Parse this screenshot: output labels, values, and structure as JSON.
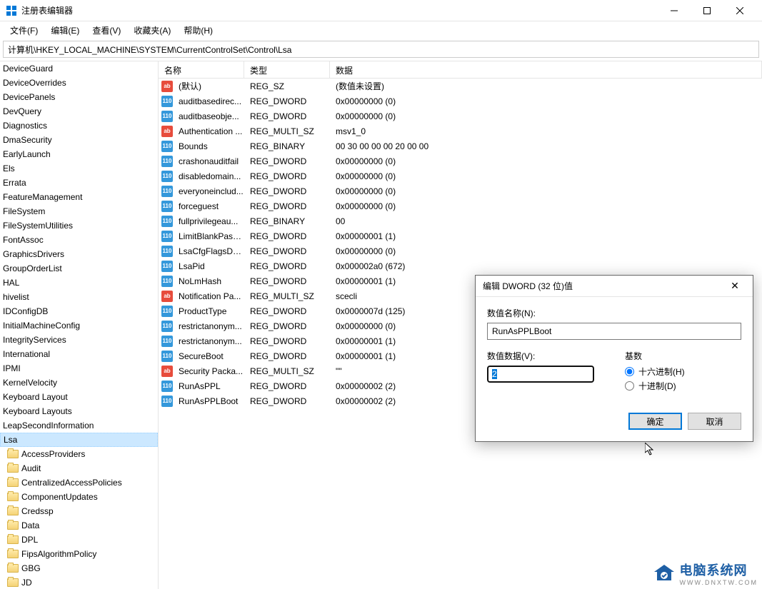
{
  "window": {
    "title": "注册表编辑器",
    "address": "计算机\\HKEY_LOCAL_MACHINE\\SYSTEM\\CurrentControlSet\\Control\\Lsa"
  },
  "menu": {
    "file": "文件(F)",
    "edit": "编辑(E)",
    "view": "查看(V)",
    "favorites": "收藏夹(A)",
    "help": "帮助(H)"
  },
  "columns": {
    "name": "名称",
    "type": "类型",
    "data": "数据"
  },
  "tree": [
    {
      "label": "DeviceGuard",
      "sub": false
    },
    {
      "label": "DeviceOverrides",
      "sub": false
    },
    {
      "label": "DevicePanels",
      "sub": false
    },
    {
      "label": "DevQuery",
      "sub": false
    },
    {
      "label": "Diagnostics",
      "sub": false
    },
    {
      "label": "DmaSecurity",
      "sub": false
    },
    {
      "label": "EarlyLaunch",
      "sub": false
    },
    {
      "label": "Els",
      "sub": false
    },
    {
      "label": "Errata",
      "sub": false
    },
    {
      "label": "FeatureManagement",
      "sub": false
    },
    {
      "label": "FileSystem",
      "sub": false
    },
    {
      "label": "FileSystemUtilities",
      "sub": false
    },
    {
      "label": "FontAssoc",
      "sub": false
    },
    {
      "label": "GraphicsDrivers",
      "sub": false
    },
    {
      "label": "GroupOrderList",
      "sub": false
    },
    {
      "label": "HAL",
      "sub": false
    },
    {
      "label": "hivelist",
      "sub": false
    },
    {
      "label": "IDConfigDB",
      "sub": false
    },
    {
      "label": "InitialMachineConfig",
      "sub": false
    },
    {
      "label": "IntegrityServices",
      "sub": false
    },
    {
      "label": "International",
      "sub": false
    },
    {
      "label": "IPMI",
      "sub": false
    },
    {
      "label": "KernelVelocity",
      "sub": false
    },
    {
      "label": "Keyboard Layout",
      "sub": false
    },
    {
      "label": "Keyboard Layouts",
      "sub": false
    },
    {
      "label": "LeapSecondInformation",
      "sub": false
    },
    {
      "label": "Lsa",
      "sub": false,
      "selected": true
    },
    {
      "label": "AccessProviders",
      "sub": true
    },
    {
      "label": "Audit",
      "sub": true
    },
    {
      "label": "CentralizedAccessPolicies",
      "sub": true
    },
    {
      "label": "ComponentUpdates",
      "sub": true
    },
    {
      "label": "Credssp",
      "sub": true
    },
    {
      "label": "Data",
      "sub": true
    },
    {
      "label": "DPL",
      "sub": true
    },
    {
      "label": "FipsAlgorithmPolicy",
      "sub": true
    },
    {
      "label": "GBG",
      "sub": true
    },
    {
      "label": "JD",
      "sub": true
    }
  ],
  "values": [
    {
      "icon": "str",
      "name": "(默认)",
      "type": "REG_SZ",
      "data": "(数值未设置)"
    },
    {
      "icon": "bin",
      "name": "auditbasedirec...",
      "type": "REG_DWORD",
      "data": "0x00000000 (0)"
    },
    {
      "icon": "bin",
      "name": "auditbaseobje...",
      "type": "REG_DWORD",
      "data": "0x00000000 (0)"
    },
    {
      "icon": "str",
      "name": "Authentication ...",
      "type": "REG_MULTI_SZ",
      "data": "msv1_0"
    },
    {
      "icon": "bin",
      "name": "Bounds",
      "type": "REG_BINARY",
      "data": "00 30 00 00 00 20 00 00"
    },
    {
      "icon": "bin",
      "name": "crashonauditfail",
      "type": "REG_DWORD",
      "data": "0x00000000 (0)"
    },
    {
      "icon": "bin",
      "name": "disabledomain...",
      "type": "REG_DWORD",
      "data": "0x00000000 (0)"
    },
    {
      "icon": "bin",
      "name": "everyoneinclud...",
      "type": "REG_DWORD",
      "data": "0x00000000 (0)"
    },
    {
      "icon": "bin",
      "name": "forceguest",
      "type": "REG_DWORD",
      "data": "0x00000000 (0)"
    },
    {
      "icon": "bin",
      "name": "fullprivilegeau...",
      "type": "REG_BINARY",
      "data": "00"
    },
    {
      "icon": "bin",
      "name": "LimitBlankPass...",
      "type": "REG_DWORD",
      "data": "0x00000001 (1)"
    },
    {
      "icon": "bin",
      "name": "LsaCfgFlagsDe...",
      "type": "REG_DWORD",
      "data": "0x00000000 (0)"
    },
    {
      "icon": "bin",
      "name": "LsaPid",
      "type": "REG_DWORD",
      "data": "0x000002a0 (672)"
    },
    {
      "icon": "bin",
      "name": "NoLmHash",
      "type": "REG_DWORD",
      "data": "0x00000001 (1)"
    },
    {
      "icon": "str",
      "name": "Notification Pa...",
      "type": "REG_MULTI_SZ",
      "data": "scecli"
    },
    {
      "icon": "bin",
      "name": "ProductType",
      "type": "REG_DWORD",
      "data": "0x0000007d (125)"
    },
    {
      "icon": "bin",
      "name": "restrictanonym...",
      "type": "REG_DWORD",
      "data": "0x00000000 (0)"
    },
    {
      "icon": "bin",
      "name": "restrictanonym...",
      "type": "REG_DWORD",
      "data": "0x00000001 (1)"
    },
    {
      "icon": "bin",
      "name": "SecureBoot",
      "type": "REG_DWORD",
      "data": "0x00000001 (1)"
    },
    {
      "icon": "str",
      "name": "Security Packa...",
      "type": "REG_MULTI_SZ",
      "data": "\"\""
    },
    {
      "icon": "bin",
      "name": "RunAsPPL",
      "type": "REG_DWORD",
      "data": "0x00000002 (2)"
    },
    {
      "icon": "bin",
      "name": "RunAsPPLBoot",
      "type": "REG_DWORD",
      "data": "0x00000002 (2)"
    }
  ],
  "dialog": {
    "title": "编辑 DWORD (32 位)值",
    "name_label": "数值名称(N):",
    "name_value": "RunAsPPLBoot",
    "data_label": "数值数据(V):",
    "data_value": "2",
    "base_label": "基数",
    "hex_label": "十六进制(H)",
    "dec_label": "十进制(D)",
    "ok": "确定",
    "cancel": "取消"
  },
  "watermark": {
    "main": "电脑系统网",
    "sub": "WWW.DNXTW.COM"
  }
}
